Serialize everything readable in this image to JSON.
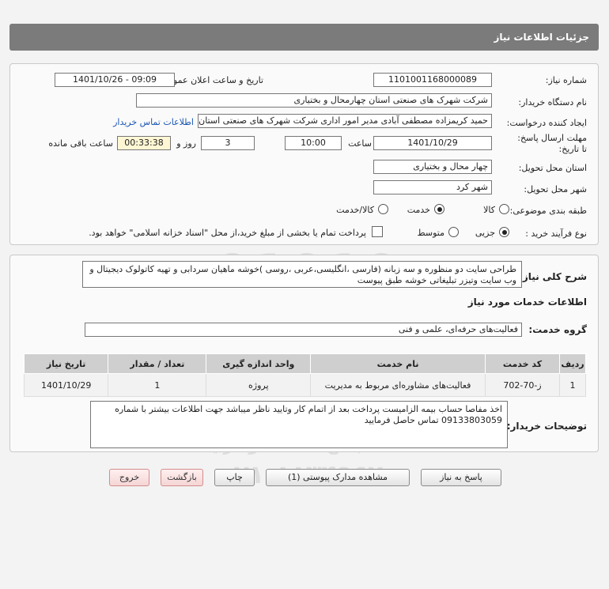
{
  "header": {
    "title": "جزئیات اطلاعات نیاز"
  },
  "form": {
    "need_number_label": "شماره نیاز:",
    "need_number": "1101001168000089",
    "announce_label": "تاریخ و ساعت اعلان عمومی:",
    "announce_value": "1401/10/26 - 09:09",
    "buyer_org_label": "نام دستگاه خریدار:",
    "buyer_org": "شرکت شهرک های صنعتی استان چهارمحال و بختیاری",
    "creator_label": "ایجاد کننده درخواست:",
    "creator": "حمید کریمزاده مصطفی آبادی مدیر امور اداری شرکت شهرک های صنعتی استان",
    "contact_link": "اطلاعات تماس خریدار",
    "deadline_label": "مهلت ارسال پاسخ: تا تاریخ:",
    "deadline_date": "1401/10/29",
    "time_label": "ساعت",
    "deadline_time": "10:00",
    "days_value": "3",
    "days_label": "روز و",
    "remaining_time": "00:33:38",
    "remaining_label": "ساعت باقی مانده",
    "province_label": "استان محل تحویل:",
    "province": "چهار محال و بختیاری",
    "city_label": "شهر محل تحویل:",
    "city": "شهر کرد",
    "category_label": "طبقه بندی موضوعی:",
    "category_options": [
      "کالا",
      "خدمت",
      "کالا/خدمت"
    ],
    "category_selected": "خدمت",
    "process_label": "نوع فرآیند خرید :",
    "process_options": [
      "جزیی",
      "متوسط"
    ],
    "process_selected": "جزیی",
    "payment_note": "پرداخت تمام یا بخشی از مبلغ خرید،از محل \"اسناد خزانه اسلامی\" خواهد بود."
  },
  "summary": {
    "label": "شرح کلی نیاز:",
    "text": "طراحی سایت دو منظوره و سه زبانه (فارسی ،انگلیسی،عربی ،روسی )خوشه ماهیان سردابی و تهیه کاتولوک دیجیتال و وب سایت وتیزر تبلیغاتی خوشه طبق پیوست"
  },
  "services": {
    "section_title": "اطلاعات خدمات مورد نیاز",
    "group_label": "گروه خدمت:",
    "group_value": "فعالیت‌های حرفه‌ای، علمی و فنی",
    "columns": [
      "ردیف",
      "کد خدمت",
      "نام خدمت",
      "واحد اندازه گیری",
      "تعداد / مقدار",
      "تاریخ نیاز"
    ],
    "rows": [
      {
        "index": "1",
        "code": "ز-70-702",
        "name": "فعالیت‌های مشاوره‌ای مربوط به مدیریت",
        "unit": "پروژه",
        "qty": "1",
        "date": "1401/10/29"
      }
    ]
  },
  "buyer_notes": {
    "label": "توضیحات خریدار:",
    "text": "اخذ مفاصا حساب بیمه الزامیست پرداخت بعد از اتمام کار وتایید ناظر میباشد جهت اطلاعات بیشتر با شماره 09133803059 تماس حاصل فرمایید"
  },
  "buttons": {
    "reply": "پاسخ به نیاز",
    "view_docs": "مشاهده مدارک پیوستی (1)",
    "print": "چاپ",
    "back": "بازگشت",
    "exit": "خروج"
  },
  "watermark": {
    "digits": "01010\n0001\n01010",
    "name": "ParsNamadData",
    "sub": "مرکز فراوری اطلاعات پارس نماد داده\nسامانه جامع مناقصه و مزایده",
    "phone": "۰۲۱-۸۸۳۴۹۶۷۰"
  },
  "colors": {
    "titlebar": "#7b7b7b",
    "link": "#1a56b3",
    "table_header": "#cfcfcf",
    "timer_bg": "#fff7d4"
  }
}
